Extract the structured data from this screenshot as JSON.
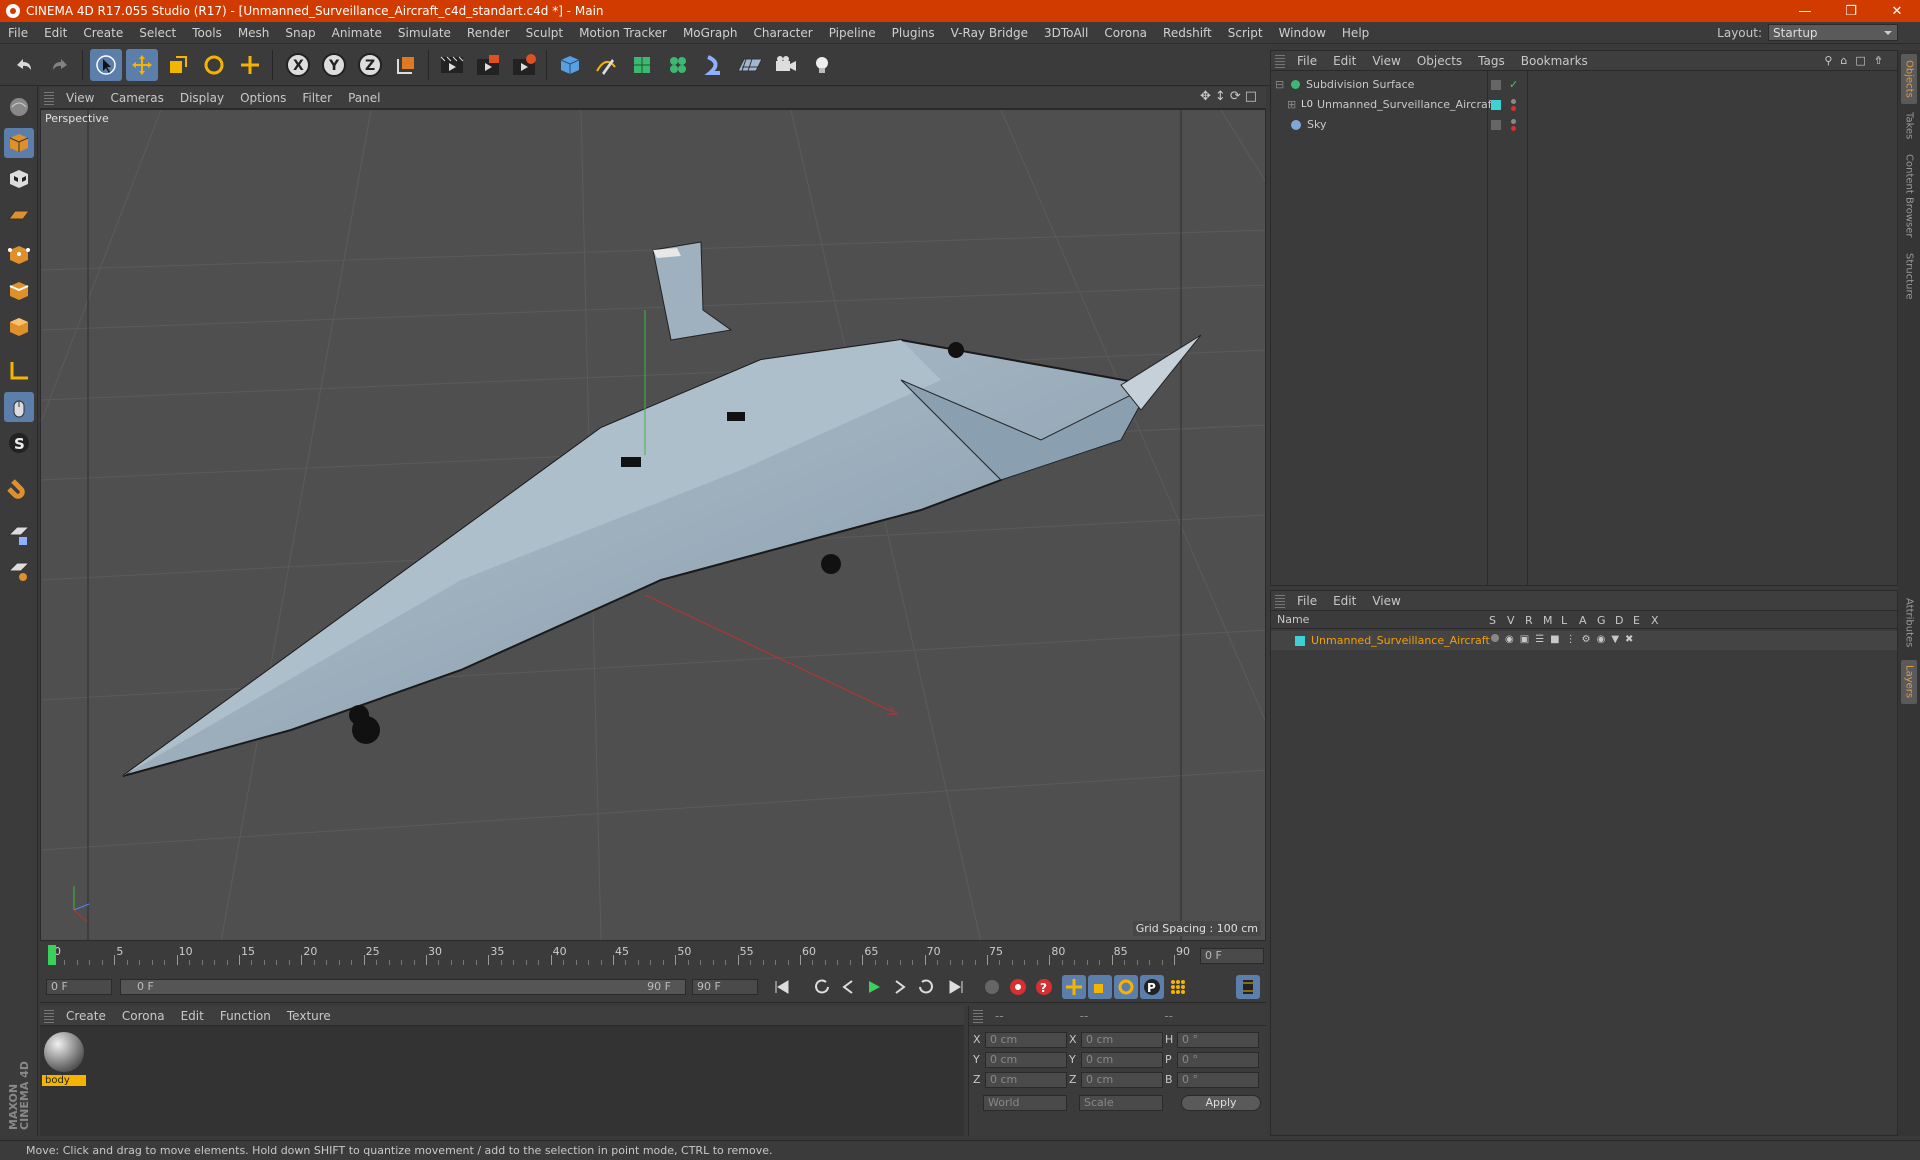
{
  "window": {
    "title": "CINEMA 4D R17.055 Studio (R17) - [Unmanned_Surveillance_Aircraft_c4d_standart.c4d *] - Main"
  },
  "menu": [
    "File",
    "Edit",
    "Create",
    "Select",
    "Tools",
    "Mesh",
    "Snap",
    "Animate",
    "Simulate",
    "Render",
    "Sculpt",
    "Motion Tracker",
    "MoGraph",
    "Character",
    "Pipeline",
    "Plugins",
    "V-Ray Bridge",
    "3DToAll",
    "Corona",
    "Redshift",
    "Script",
    "Window",
    "Help"
  ],
  "layout": {
    "label": "Layout:",
    "value": "Startup"
  },
  "viewport": {
    "menu": [
      "View",
      "Cameras",
      "Display",
      "Options",
      "Filter",
      "Panel"
    ],
    "label": "Perspective",
    "grid_spacing": "Grid Spacing : 100 cm"
  },
  "timeline": {
    "ticks": [
      "0",
      "5",
      "10",
      "15",
      "20",
      "25",
      "30",
      "35",
      "40",
      "45",
      "50",
      "55",
      "60",
      "65",
      "70",
      "75",
      "80",
      "85",
      "90"
    ],
    "current_frame": "0 F",
    "start": "0 F",
    "range_start": "0 F",
    "range_end": "90 F",
    "end": "90 F"
  },
  "material_menu": [
    "Create",
    "Corona",
    "Edit",
    "Function",
    "Texture"
  ],
  "material": {
    "name": "body"
  },
  "coords": {
    "headers": [
      "--",
      "--",
      "--"
    ],
    "rows": [
      {
        "a": "X",
        "av": "0 cm",
        "b": "X",
        "bv": "0 cm",
        "c": "H",
        "cv": "0 °"
      },
      {
        "a": "Y",
        "av": "0 cm",
        "b": "Y",
        "bv": "0 cm",
        "c": "P",
        "cv": "0 °"
      },
      {
        "a": "Z",
        "av": "0 cm",
        "b": "Z",
        "bv": "0 cm",
        "c": "B",
        "cv": "0 °"
      }
    ],
    "mode1": "World",
    "mode2": "Scale",
    "apply": "Apply"
  },
  "objects": {
    "menu": [
      "File",
      "Edit",
      "View",
      "Objects",
      "Tags",
      "Bookmarks"
    ],
    "items": [
      "Subdivision Surface",
      "Unmanned_Surveillance_Aircraft",
      "Sky"
    ]
  },
  "layers": {
    "menu": [
      "File",
      "Edit",
      "View"
    ],
    "header_name": "Name",
    "cols": [
      "S",
      "V",
      "R",
      "M",
      "L",
      "A",
      "G",
      "D",
      "E",
      "X"
    ],
    "item": "Unmanned_Surveillance_Aircraft",
    "color": "#3fd1d6"
  },
  "side_tabs": [
    "Objects",
    "Takes",
    "Content Browser",
    "Structure",
    "Attributes",
    "Layers"
  ],
  "status": "Move: Click and drag to move elements. Hold down SHIFT to quantize movement / add to the selection in point mode, CTRL to remove.",
  "brand": "MAXON CINEMA 4D",
  "colors": {
    "accent": "#d23b00",
    "active": "#5c7eab"
  }
}
